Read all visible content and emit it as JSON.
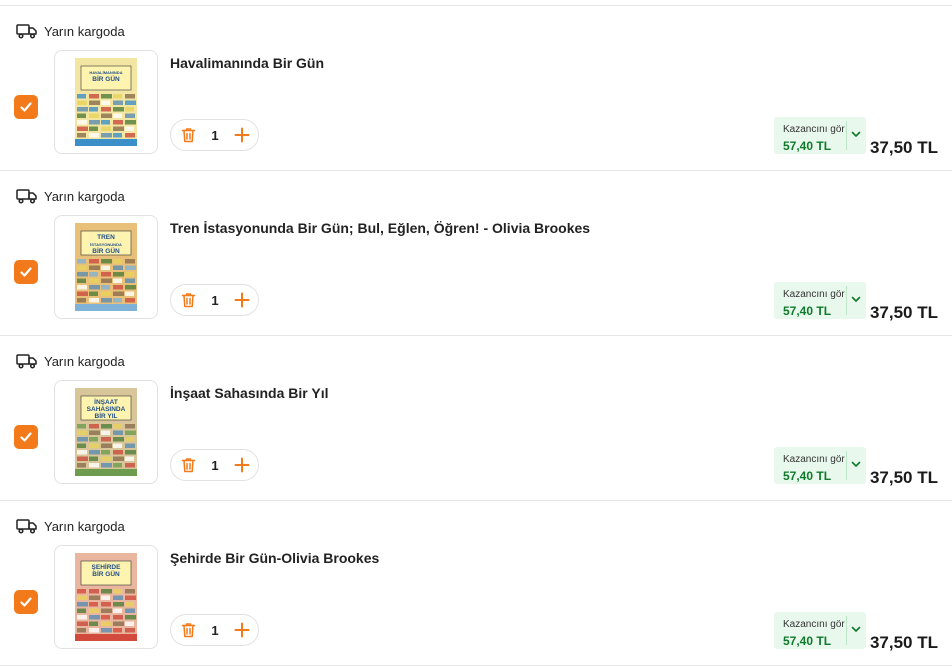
{
  "items": [
    {
      "shipping_label": "Yarın kargoda",
      "title": "Havalimanında Bir Gün",
      "cover_text": [
        "HAVALİMANINDA",
        "BİR GÜN"
      ],
      "cover_color": "#f3e6a2",
      "cover_accent": "#3b8fc9",
      "quantity": "1",
      "savings_label": "Kazancını gör",
      "savings_amount": "57,40 TL",
      "price": "37,50 TL",
      "selected": true
    },
    {
      "shipping_label": "Yarın kargoda",
      "title": "Tren İstasyonunda Bir Gün; Bul, Eğlen, Öğren! - Olivia Brookes",
      "cover_text": [
        "TREN",
        "İSTASYONUNDA",
        "BİR GÜN"
      ],
      "cover_color": "#e9c07a",
      "cover_accent": "#7fb2d6",
      "quantity": "1",
      "savings_label": "Kazancını gör",
      "savings_amount": "57,40 TL",
      "price": "37,50 TL",
      "selected": true
    },
    {
      "shipping_label": "Yarın kargoda",
      "title": "İnşaat Sahasında Bir Yıl",
      "cover_text": [
        "İNŞAAT",
        "SAHASINDA",
        "BİR YIL"
      ],
      "cover_color": "#d8c69a",
      "cover_accent": "#6d9c4e",
      "quantity": "1",
      "savings_label": "Kazancını gör",
      "savings_amount": "57,40 TL",
      "price": "37,50 TL",
      "selected": true
    },
    {
      "shipping_label": "Yarın kargoda",
      "title": "Şehirde Bir Gün-Olivia Brookes",
      "cover_text": [
        "ŞEHİRDE",
        "BİR GÜN"
      ],
      "cover_color": "#e9b7a0",
      "cover_accent": "#d24a3b",
      "quantity": "1",
      "savings_label": "Kazancını gör",
      "savings_amount": "57,40 TL",
      "price": "37,50 TL",
      "selected": true
    }
  ],
  "colors": {
    "brand_orange": "#f27a1a",
    "savings_bg": "#e9f8ec",
    "savings_text": "#0f7a2c"
  }
}
